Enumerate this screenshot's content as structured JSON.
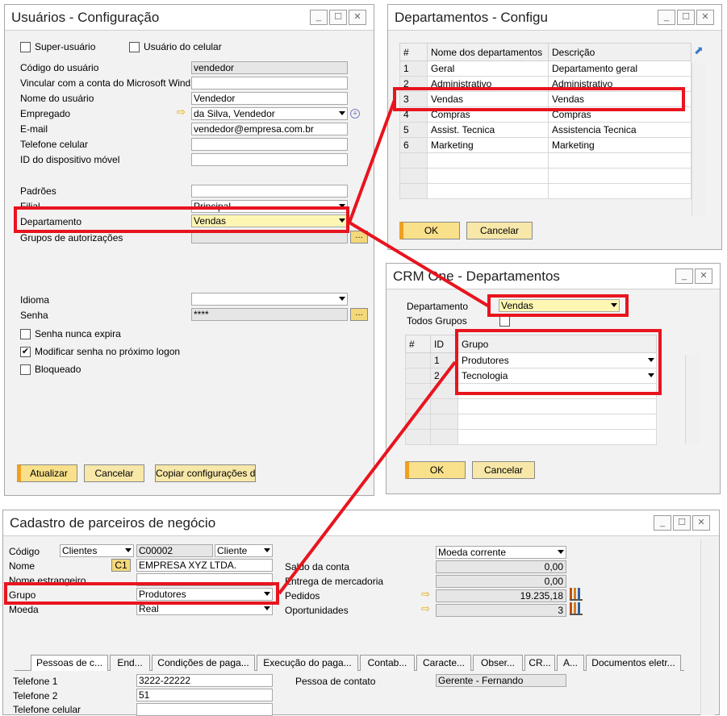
{
  "users": {
    "title": "Usuários - Configuração",
    "superuser": "Super-usuário",
    "mobile_user": "Usuário do celular",
    "code_label": "Código do usuário",
    "code_value": "vendedor",
    "ms_label": "Vincular com a conta do Microsoft Windows",
    "name_label": "Nome do usuário",
    "name_value": "Vendedor",
    "employee_label": "Empregado",
    "employee_value": "da Silva, Vendedor",
    "email_label": "E-mail",
    "email_value": "vendedor@empresa.com.br",
    "phone_label": "Telefone celular",
    "device_label": "ID do dispositivo móvel",
    "defaults_label": "Padrões",
    "branch_label": "Filial",
    "branch_value": "Principal",
    "dept_label": "Departamento",
    "dept_value": "Vendas",
    "auth_label": "Grupos de autorizações",
    "lang_label": "Idioma",
    "pwd_label": "Senha",
    "pwd_value": "****",
    "never_expire": "Senha nunca expira",
    "change_next": "Modificar senha no próximo logon",
    "blocked": "Bloqueado",
    "update_btn": "Atualizar",
    "cancel_btn": "Cancelar",
    "copy_btn": "Copiar configurações de"
  },
  "depts": {
    "title": "Departamentos - Configuração",
    "col_num": "#",
    "col_name": "Nome dos departamentos",
    "col_desc": "Descrição",
    "rows": [
      {
        "n": "1",
        "name": "Geral",
        "desc": "Departamento geral"
      },
      {
        "n": "2",
        "name": "Administrativo",
        "desc": "Administrativo"
      },
      {
        "n": "3",
        "name": "Vendas",
        "desc": "Vendas"
      },
      {
        "n": "4",
        "name": "Compras",
        "desc": "Compras"
      },
      {
        "n": "5",
        "name": "Assist. Tecnica",
        "desc": "Assistencia Tecnica"
      },
      {
        "n": "6",
        "name": "Marketing",
        "desc": "Marketing"
      }
    ],
    "ok_btn": "OK",
    "cancel_btn": "Cancelar"
  },
  "crm": {
    "title": "CRM One - Departamentos",
    "dept_label": "Departamento",
    "dept_value": "Vendas",
    "all_groups": "Todos Grupos",
    "col_num": "#",
    "col_id": "ID",
    "col_group": "Grupo",
    "rows": [
      {
        "id": "1",
        "group": "Produtores"
      },
      {
        "id": "2",
        "group": "Tecnologia"
      }
    ],
    "ok_btn": "OK",
    "cancel_btn": "Cancelar"
  },
  "bp": {
    "title": "Cadastro de parceiros de negócio",
    "code_label": "Código",
    "code_type": "Clientes",
    "code_value": "C00002",
    "code_kind": "Cliente",
    "name_label": "Nome",
    "name_badge": "C1",
    "name_value": "EMPRESA XYZ LTDA.",
    "foreign_label": "Nome estrangeiro",
    "group_label": "Grupo",
    "group_value": "Produtores",
    "currency_label": "Moeda",
    "currency_value": "Real",
    "balance_label": "Saldo da conta",
    "delivery_label": "Entrega de mercadoria",
    "orders_label": "Pedidos",
    "opps_label": "Oportunidades",
    "currency_select": "Moeda corrente",
    "balance_value": "0,00",
    "delivery_value": "0,00",
    "orders_value": "19.235,18",
    "opps_value": "3",
    "tabs": [
      "Pessoas de c...",
      "End...",
      "Condições de paga...",
      "Execução do paga...",
      "Contab...",
      "Caracte...",
      "Obser...",
      "CR...",
      "A...",
      "Documentos eletr..."
    ],
    "phone1_label": "Telefone 1",
    "phone1_value": "3222-22222",
    "phone2_label": "Telefone 2",
    "phone2_value": "51",
    "mobile_label": "Telefone celular",
    "contact_label": "Pessoa de contato",
    "contact_value": "Gerente - Fernando"
  },
  "colors": {
    "highlight": "#e8141e",
    "field_yellow": "#fef7b4",
    "button": "#f9e08a"
  },
  "icons": [
    "minimize-icon",
    "maximize-icon",
    "close-icon",
    "dropdown-arrow-icon",
    "link-arrow-icon",
    "chart-icon",
    "checkbox-checked-icon"
  ]
}
